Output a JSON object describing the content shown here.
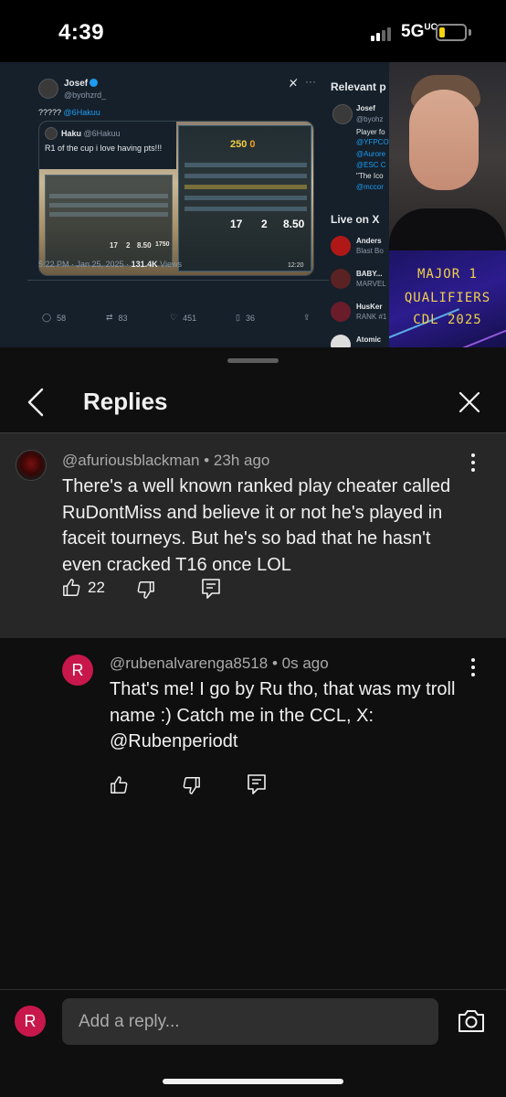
{
  "status_bar": {
    "time": "4:39",
    "network": "5G",
    "network_sup": "UC",
    "battery_color": "#f5d20b"
  },
  "video": {
    "tweet": {
      "author_name": "Josef",
      "author_handle": "@byohzrd_",
      "text": "?????",
      "mention": "@6Hakuu",
      "quoted_name": "Haku",
      "quoted_handle": "@6Hakuu",
      "quoted_text": "R1 of the cup i love having pts!!!",
      "score_top": "250",
      "score_top_b": "0",
      "stat_left_1": "17",
      "stat_left_2": "2",
      "stat_left_3": "8.50",
      "stat_left_4": "1750",
      "stat_right_1": "17",
      "stat_right_2": "2",
      "stat_right_3": "8.50",
      "stat_right_4": "17",
      "timestamp": "12:20",
      "meta_time": "5:22 PM · Jan 25, 2025 ·",
      "meta_views": "131.4K",
      "meta_views_label": "Views",
      "replies": "58",
      "retweets": "83",
      "likes": "451",
      "bookmarks": "36"
    },
    "relevant": {
      "title": "Relevant p",
      "person_name": "Josef",
      "person_handle": "@byohz",
      "person_bio_1": "Player fo",
      "person_bio_2": "@YFPCO",
      "person_bio_3": "@Aurore",
      "person_bio_4": "@ESC C",
      "person_bio_5": "\"The Ico",
      "person_bio_6": "@mccor"
    },
    "live": {
      "title": "Live on X",
      "items": [
        {
          "name": "Anders",
          "sub": "Blast Bo"
        },
        {
          "name": "BABY...",
          "sub": "MARVEL"
        },
        {
          "name": "HusKer",
          "sub": "RANK #1"
        },
        {
          "name": "Atomic",
          "sub": ""
        }
      ]
    },
    "banner": {
      "line1": "MAJOR 1",
      "line2": "QUALIFIERS",
      "line3": "CDL 2025"
    }
  },
  "sheet": {
    "title": "Replies",
    "parent": {
      "handle": "@afuriousblackman",
      "time": "23h ago",
      "lines": [
        "There's a well known ranked play cheater called",
        "RuDontMiss and believe it or not he's played in",
        "faceit tourneys. But he's so bad that he hasn't",
        "even cracked T16 once LOL"
      ],
      "likes": "22"
    },
    "reply": {
      "avatar_letter": "R",
      "handle": "@rubenalvarenga8518",
      "time": "0s ago",
      "lines": [
        "That's me! I go by Ru tho, that was my troll",
        "name :) Catch me in the CCL, X:",
        "@Rubenperiodt"
      ]
    },
    "input": {
      "avatar_letter": "R",
      "placeholder": "Add a reply..."
    },
    "colors": {
      "avatar_accent": "#c7174b",
      "background": "#0f0f0f",
      "highlight_bg": "#272727"
    }
  }
}
